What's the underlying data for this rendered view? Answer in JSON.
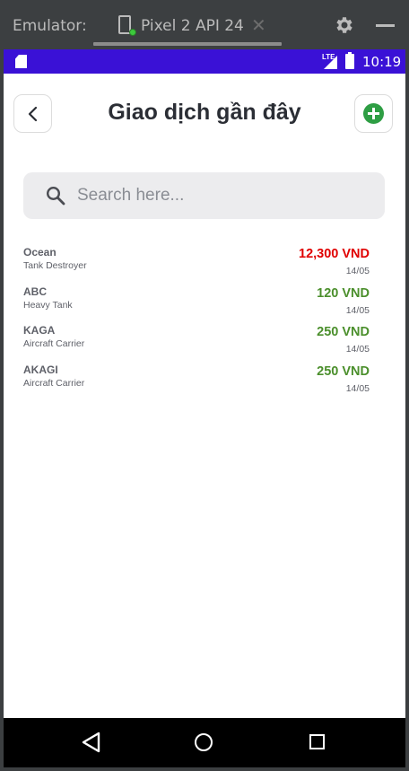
{
  "emulator": {
    "label": "Emulator:",
    "tab_label": "Pixel 2 API 24",
    "tab_close": "✕"
  },
  "status_bar": {
    "network": "LTE",
    "time": "10:19"
  },
  "header": {
    "title": "Giao dịch gần đây"
  },
  "search": {
    "placeholder": "Search here..."
  },
  "transactions": [
    {
      "name": "Ocean",
      "type": "Tank Destroyer",
      "amount": "12,300 VND",
      "date": "14/05",
      "amount_color": "#e00000"
    },
    {
      "name": "ABC",
      "type": "Heavy Tank",
      "amount": "120 VND",
      "date": "14/05",
      "amount_color": "#4b8f2c"
    },
    {
      "name": "KAGA",
      "type": "Aircraft Carrier",
      "amount": "250 VND",
      "date": "14/05",
      "amount_color": "#4b8f2c"
    },
    {
      "name": "AKAGI",
      "type": "Aircraft Carrier",
      "amount": "250 VND",
      "date": "14/05",
      "amount_color": "#4b8f2c"
    }
  ],
  "colors": {
    "status_bar": "#3a11d6",
    "add_button": "#2e9e44",
    "negative": "#e00000",
    "positive": "#4b8f2c"
  },
  "icons": {
    "back": "chevron-left-icon",
    "add": "plus-circle-icon",
    "search": "search-icon",
    "settings": "gear-icon"
  }
}
